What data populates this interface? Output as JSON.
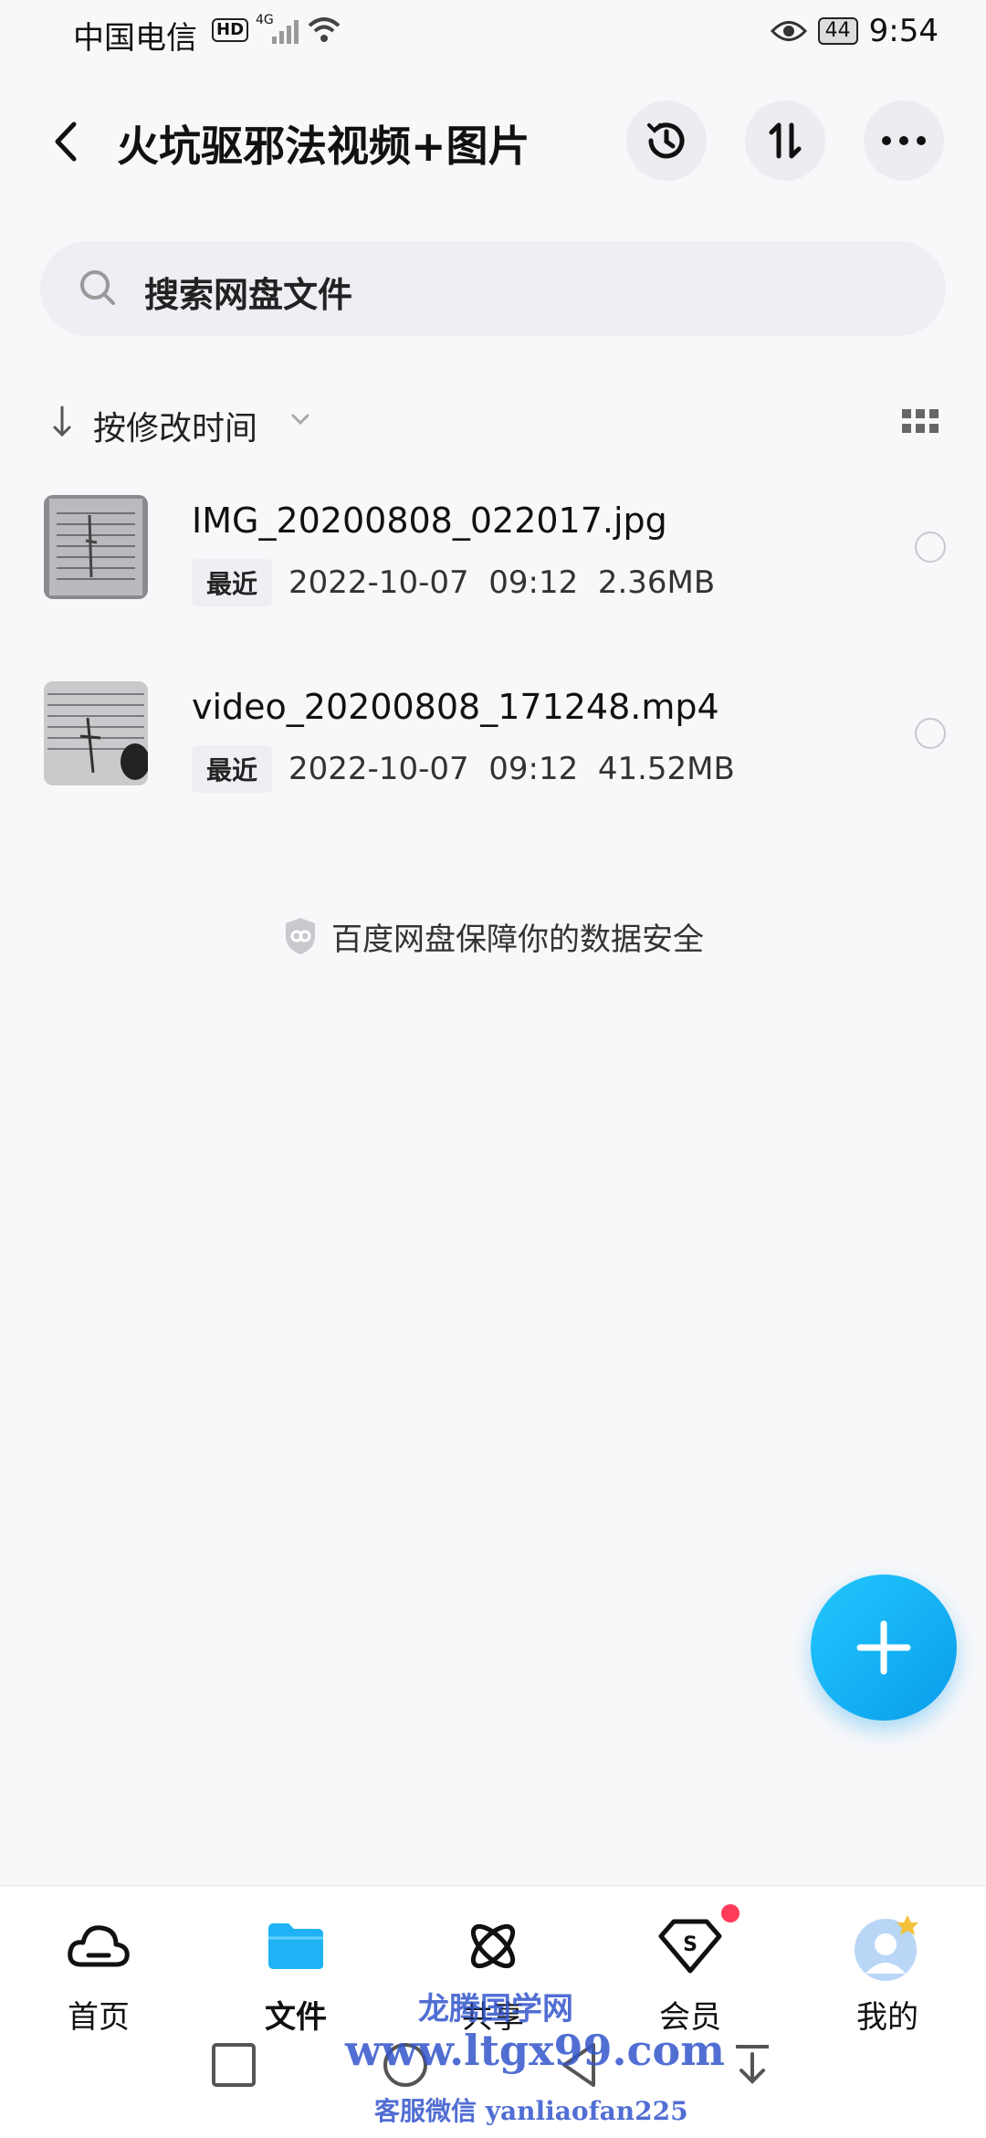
{
  "status_bar": {
    "carrier": "中国电信",
    "hd": "HD",
    "network": "4G",
    "battery": "44",
    "time": "9:54"
  },
  "header": {
    "title": "火坑驱邪法视频+图片"
  },
  "search": {
    "placeholder": "搜索网盘文件"
  },
  "sort": {
    "label": "按修改时间"
  },
  "files": [
    {
      "name": "IMG_20200808_022017.jpg",
      "tag": "最近",
      "meta": "2022-10-07  09:12  2.36MB"
    },
    {
      "name": "video_20200808_171248.mp4",
      "tag": "最近",
      "meta": "2022-10-07  09:12  41.52MB"
    }
  ],
  "security_note": "百度网盘保障你的数据安全",
  "bottom_nav": [
    {
      "label": "首页",
      "icon": "cloud-icon"
    },
    {
      "label": "文件",
      "icon": "folder-icon"
    },
    {
      "label": "共享",
      "icon": "atom-icon"
    },
    {
      "label": "会员",
      "icon": "vip-diamond-icon"
    },
    {
      "label": "我的",
      "icon": "avatar-icon"
    }
  ],
  "watermark": {
    "site_name": "龙腾国学网",
    "url": "www.ltgx99.com",
    "contact": "客服微信 yanliaofan225"
  },
  "colors": {
    "accent": "#0a9dea",
    "folder_blue": "#1fb3f5",
    "badge_red": "#ff3b5c",
    "background": "#f8f8fa"
  }
}
